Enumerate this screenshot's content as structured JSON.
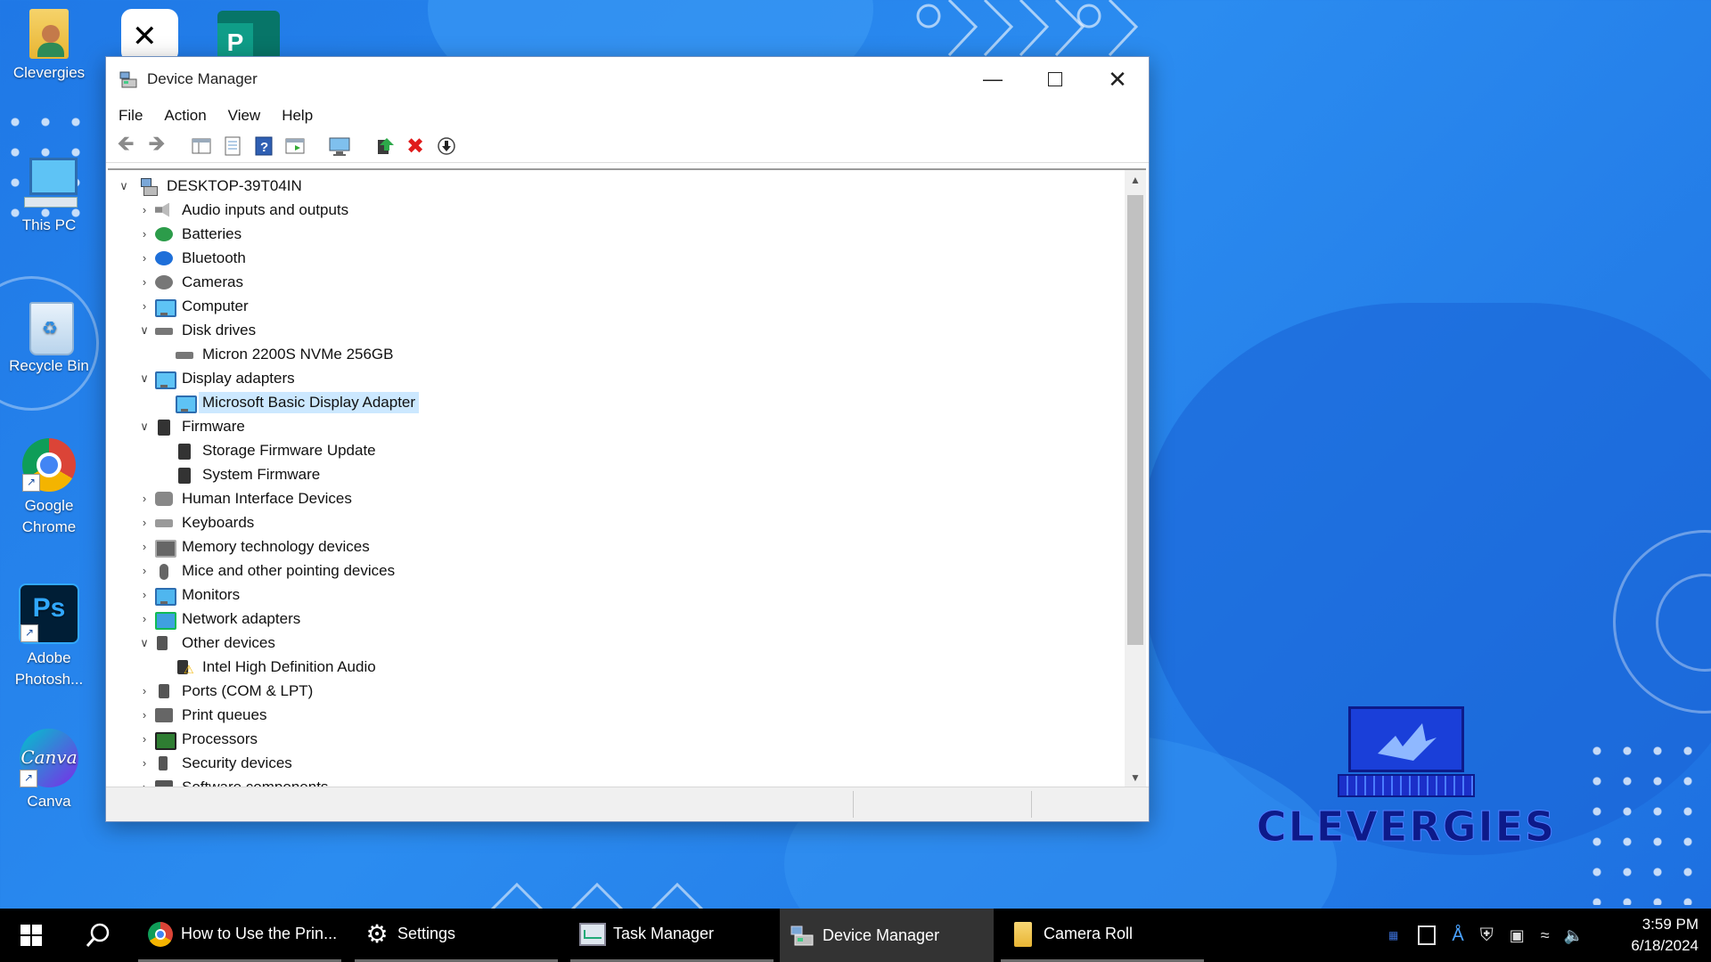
{
  "desktop": {
    "icons": [
      {
        "label": "Clevergies"
      },
      {
        "label": "This PC"
      },
      {
        "label": "Recycle Bin"
      },
      {
        "label": "Google Chrome"
      },
      {
        "label": "Adobe Photosh..."
      },
      {
        "label": "Canva"
      }
    ],
    "top_apps": [
      "capcut-icon",
      "publisher-icon"
    ]
  },
  "window": {
    "title": "Device Manager",
    "menu": [
      "File",
      "Action",
      "View",
      "Help"
    ],
    "toolbar_icons": [
      "back-arrow-icon",
      "forward-arrow-icon",
      "show-hide-console-tree-icon",
      "properties-icon",
      "help-icon",
      "action-pane-icon",
      "scan-hardware-icon",
      "update-driver-icon",
      "uninstall-icon",
      "disable-device-icon"
    ],
    "tree": {
      "root": "DESKTOP-39T04IN",
      "items": [
        {
          "label": "Audio inputs and outputs",
          "level": 1,
          "expand": "collapsed",
          "icon": "speaker-icon"
        },
        {
          "label": "Batteries",
          "level": 1,
          "expand": "collapsed",
          "icon": "battery-icon"
        },
        {
          "label": "Bluetooth",
          "level": 1,
          "expand": "collapsed",
          "icon": "bluetooth-icon"
        },
        {
          "label": "Cameras",
          "level": 1,
          "expand": "collapsed",
          "icon": "camera-icon"
        },
        {
          "label": "Computer",
          "level": 1,
          "expand": "collapsed",
          "icon": "computer-icon"
        },
        {
          "label": "Disk drives",
          "level": 1,
          "expand": "expanded",
          "icon": "disk-drive-icon"
        },
        {
          "label": "Micron 2200S NVMe 256GB",
          "level": 2,
          "expand": "none",
          "icon": "disk-drive-icon"
        },
        {
          "label": "Display adapters",
          "level": 1,
          "expand": "expanded",
          "icon": "display-adapter-icon"
        },
        {
          "label": "Microsoft Basic Display Adapter",
          "level": 2,
          "expand": "none",
          "icon": "display-adapter-icon",
          "selected": true
        },
        {
          "label": "Firmware",
          "level": 1,
          "expand": "expanded",
          "icon": "firmware-icon"
        },
        {
          "label": "Storage Firmware Update",
          "level": 2,
          "expand": "none",
          "icon": "firmware-icon"
        },
        {
          "label": "System Firmware",
          "level": 2,
          "expand": "none",
          "icon": "firmware-icon"
        },
        {
          "label": "Human Interface Devices",
          "level": 1,
          "expand": "collapsed",
          "icon": "hid-icon"
        },
        {
          "label": "Keyboards",
          "level": 1,
          "expand": "collapsed",
          "icon": "keyboard-icon"
        },
        {
          "label": "Memory technology devices",
          "level": 1,
          "expand": "collapsed",
          "icon": "memory-icon"
        },
        {
          "label": "Mice and other pointing devices",
          "level": 1,
          "expand": "collapsed",
          "icon": "mouse-icon"
        },
        {
          "label": "Monitors",
          "level": 1,
          "expand": "collapsed",
          "icon": "monitor-icon"
        },
        {
          "label": "Network adapters",
          "level": 1,
          "expand": "collapsed",
          "icon": "network-adapter-icon"
        },
        {
          "label": "Other devices",
          "level": 1,
          "expand": "expanded",
          "icon": "unknown-device-icon"
        },
        {
          "label": "Intel High Definition Audio",
          "level": 2,
          "expand": "none",
          "icon": "warning-device-icon"
        },
        {
          "label": "Ports (COM & LPT)",
          "level": 1,
          "expand": "collapsed",
          "icon": "port-icon"
        },
        {
          "label": "Print queues",
          "level": 1,
          "expand": "collapsed",
          "icon": "printer-icon"
        },
        {
          "label": "Processors",
          "level": 1,
          "expand": "collapsed",
          "icon": "processor-icon"
        },
        {
          "label": "Security devices",
          "level": 1,
          "expand": "collapsed",
          "icon": "security-device-icon"
        },
        {
          "label": "Software components",
          "level": 1,
          "expand": "collapsed",
          "icon": "software-component-icon"
        }
      ]
    }
  },
  "logo": {
    "text": "CLEVERGIES"
  },
  "taskbar": {
    "items": [
      {
        "label": "How to Use the Prin...",
        "icon": "chrome-icon"
      },
      {
        "label": "Settings",
        "icon": "gear-icon"
      },
      {
        "label": "Task Manager",
        "icon": "task-manager-icon"
      },
      {
        "label": "Device Manager",
        "icon": "device-manager-icon",
        "active": true
      },
      {
        "label": "Camera Roll",
        "icon": "folder-icon"
      }
    ],
    "time": "3:59 PM",
    "date": "6/18/2024"
  },
  "colors": {
    "desktop": "#1f78e6",
    "selection": "#cce8ff",
    "taskbar": "#000000",
    "logo": "#0d1a8a"
  }
}
